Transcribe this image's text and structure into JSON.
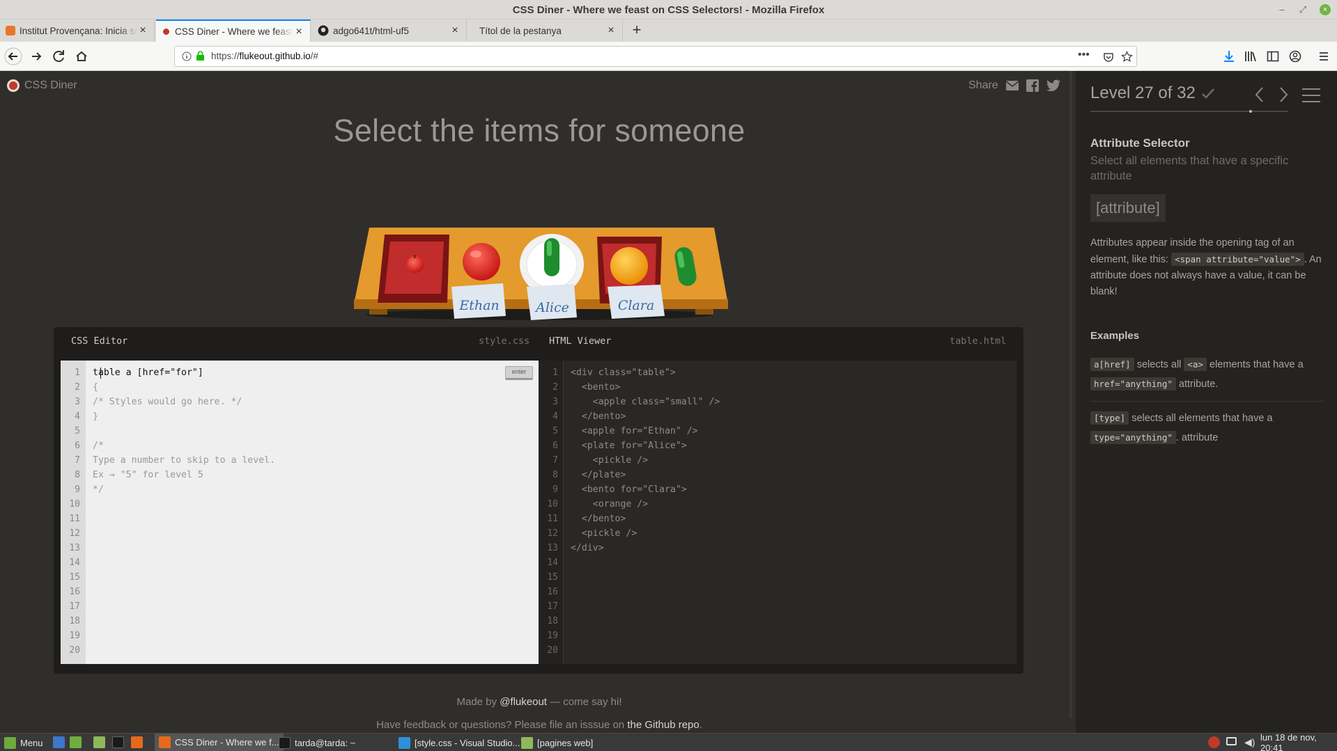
{
  "window": {
    "title": "CSS Diner - Where we feast on CSS Selectors! - Mozilla Firefox"
  },
  "tabs": [
    {
      "label": "Institut Provençana: Inicia se",
      "active": false
    },
    {
      "label": "CSS Diner - Where we feast o",
      "active": true
    },
    {
      "label": "adgo641t/html-uf5",
      "active": false
    },
    {
      "label": "Títol de la pestanya",
      "active": false
    }
  ],
  "urlbar": {
    "scheme": "https://",
    "host": "flukeout.github.io",
    "path": "/#"
  },
  "page": {
    "logo": "CSS Diner",
    "share_label": "Share",
    "heading": "Select the items for someone",
    "table_tags": [
      "Ethan",
      "Alice",
      "Clara"
    ],
    "footer_made_by": "Made by",
    "footer_author": "@flukeout",
    "footer_suffix": "— come say hi!",
    "footer_feedback": "Have feedback or questions? Please file an isssue on",
    "footer_repo": "the Github repo",
    "footer_period": "."
  },
  "editor": {
    "css_title": "CSS Editor",
    "css_file": "style.css",
    "html_title": "HTML Viewer",
    "html_file": "table.html",
    "enter_label": "enter",
    "css_lines": [
      "table a [href=\"for\"]",
      "{",
      "/* Styles would go here. */",
      "}",
      "",
      "/*",
      "Type a number to skip to a level.",
      "Ex → \"5\" for level 5",
      "*/",
      "",
      "",
      "",
      "",
      "",
      "",
      "",
      "",
      "",
      "",
      ""
    ],
    "html_lines": [
      "<div class=\"table\">",
      "  <bento>",
      "    <apple class=\"small\" />",
      "  </bento>",
      "  <apple for=\"Ethan\" />",
      "  <plate for=\"Alice\">",
      "    <pickle />",
      "  </plate>",
      "  <bento for=\"Clara\">",
      "    <orange />",
      "  </bento>",
      "  <pickle />",
      "</div>",
      "",
      "",
      "",
      "",
      "",
      "",
      ""
    ],
    "line_numbers": [
      "1",
      "2",
      "3",
      "4",
      "5",
      "6",
      "7",
      "8",
      "9",
      "10",
      "11",
      "12",
      "13",
      "14",
      "15",
      "16",
      "17",
      "18",
      "19",
      "20"
    ]
  },
  "sidebar": {
    "level_label": "Level 27 of 32",
    "level_current": 27,
    "level_total": 32,
    "selector_name": "Attribute Selector",
    "selector_title": "Select all elements that have a specific attribute",
    "syntax": "[attribute]",
    "help_1": "Attributes appear inside the opening tag of an element, like this:",
    "help_code": "<span attribute=\"value\">",
    "help_2": ". An attribute does not always have a value, it can be blank!",
    "examples_title": "Examples",
    "ex1_code": "a[href]",
    "ex1_text1": "selects all",
    "ex1_code2": "<a>",
    "ex1_text2": "elements that have a",
    "ex1_code3": "href=\"anything\"",
    "ex1_text3": "attribute.",
    "ex2_code": "[type]",
    "ex2_text1": "selects all elements that have a",
    "ex2_code2": "type=\"anything\"",
    "ex2_text2": ". attribute"
  },
  "taskbar": {
    "menu": "Menu",
    "items": [
      "CSS Diner - Where we f...",
      "tarda@tarda: ~",
      "[style.css - Visual Studio...",
      "[pagines web]"
    ],
    "clock": "lun 18 de nov, 20:41"
  },
  "colors": {
    "accent": "#0a84ff",
    "page_bg": "#302e2b",
    "sidebar_bg": "#252320"
  }
}
